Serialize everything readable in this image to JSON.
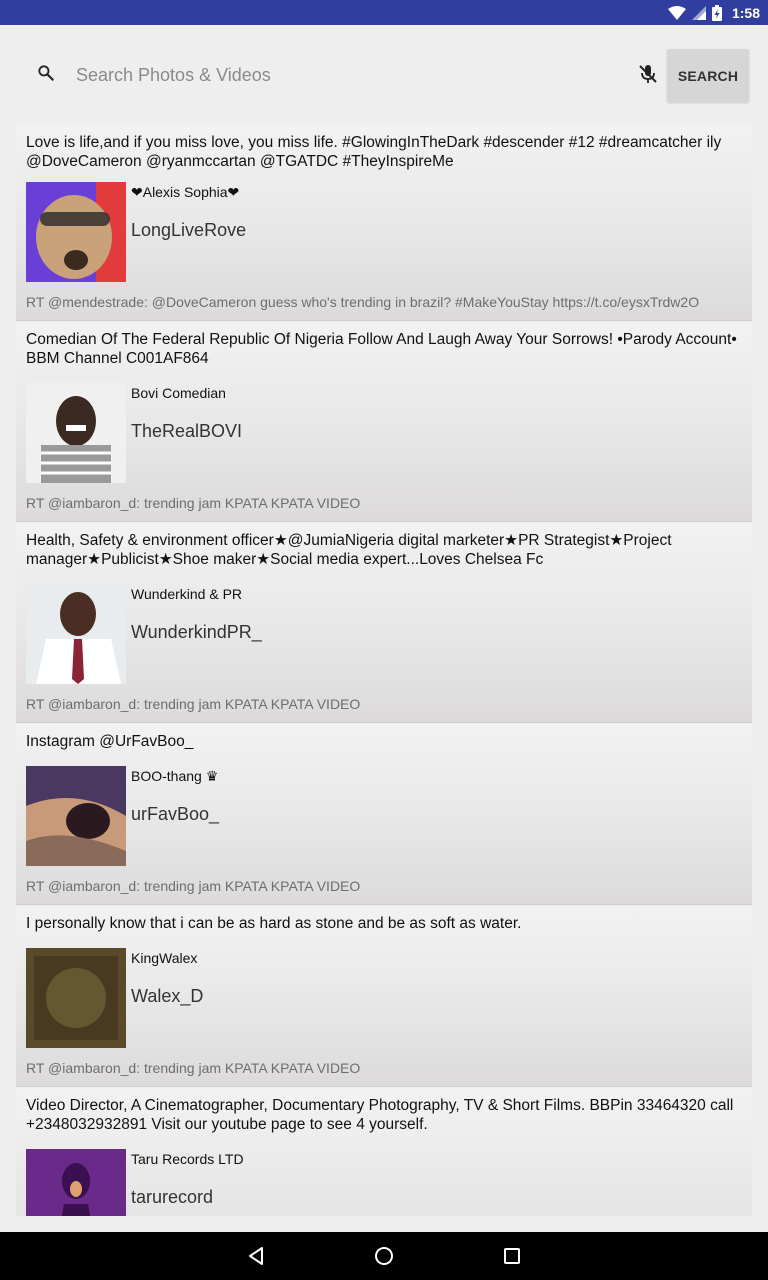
{
  "status_bar": {
    "time": "1:58",
    "icons": [
      "wifi-icon",
      "cell-signal-icon",
      "battery-icon"
    ]
  },
  "search": {
    "placeholder": "Search Photos & Videos",
    "value": "",
    "button_label": "SEARCH",
    "icons": [
      "search-icon",
      "mic-off-icon"
    ]
  },
  "feed": {
    "items": [
      {
        "description": "Love is life,and if you miss love, you miss life. #GlowingInTheDark #descender #12 #dreamcatcher ily @DoveCameron @ryanmccartan @TGATDC #TheyInspireMe",
        "name": "❤Alexis Sophia❤",
        "handle": "LongLiveRove",
        "tweet": "RT @mendestrade: @DoveCameron guess who's trending in brazil?  #MakeYouStay https://t.co/eysxTrdw2O",
        "avatar_colors": [
          "#6a3fd8",
          "#e23b3b",
          "#c9a27a"
        ]
      },
      {
        "description": "Comedian Of The Federal Republic Of Nigeria Follow And Laugh Away Your Sorrows! •Parody Account• BBM Channel C001AF864",
        "name": "Bovi Comedian",
        "handle": "TheRealBOVI",
        "tweet": "RT @iambaron_d: trending jam KPATA KPATA VIDEO",
        "avatar_colors": [
          "#f0f0f0",
          "#3a2a22",
          "#9a9a9a"
        ]
      },
      {
        "description": "Health, Safety & environment officer★@JumiaNigeria digital marketer★PR Strategist★Project manager★Publicist★Shoe maker★Social media expert...Loves Chelsea Fc",
        "name": "Wunderkind & PR",
        "handle": "WunderkindPR_",
        "tweet": "RT @iambaron_d: trending jam KPATA KPATA VIDEO",
        "avatar_colors": [
          "#e8ecef",
          "#4a2e24",
          "#8a2238"
        ]
      },
      {
        "description": "Instagram @UrFavBoo_",
        "name": "BOO-thang ♛",
        "handle": "urFavBoo_",
        "tweet": "RT @iambaron_d: trending jam KPATA KPATA VIDEO",
        "avatar_colors": [
          "#4a3860",
          "#c89a7a",
          "#2a1a20"
        ]
      },
      {
        "description": "I personally know that i can be as hard as stone and be as soft as water.",
        "name": "KingWalex",
        "handle": "Walex_D",
        "tweet": "RT @iambaron_d: trending jam KPATA KPATA VIDEO",
        "avatar_colors": [
          "#5a4a2a",
          "#3a301c",
          "#7a6a3a"
        ]
      },
      {
        "description": "Video Director, A Cinematographer, Documentary Photography, TV & Short Films. BBPin 33464320 call +2348032932891 Visit our youtube page to see 4 yourself.",
        "name": "Taru Records LTD",
        "handle": "tarurecord",
        "tweet": "",
        "avatar_colors": [
          "#6a2a8a",
          "#e0a070",
          "#3a1050"
        ]
      }
    ]
  },
  "nav": {
    "icons": [
      "back-icon",
      "home-icon",
      "recents-icon"
    ]
  }
}
